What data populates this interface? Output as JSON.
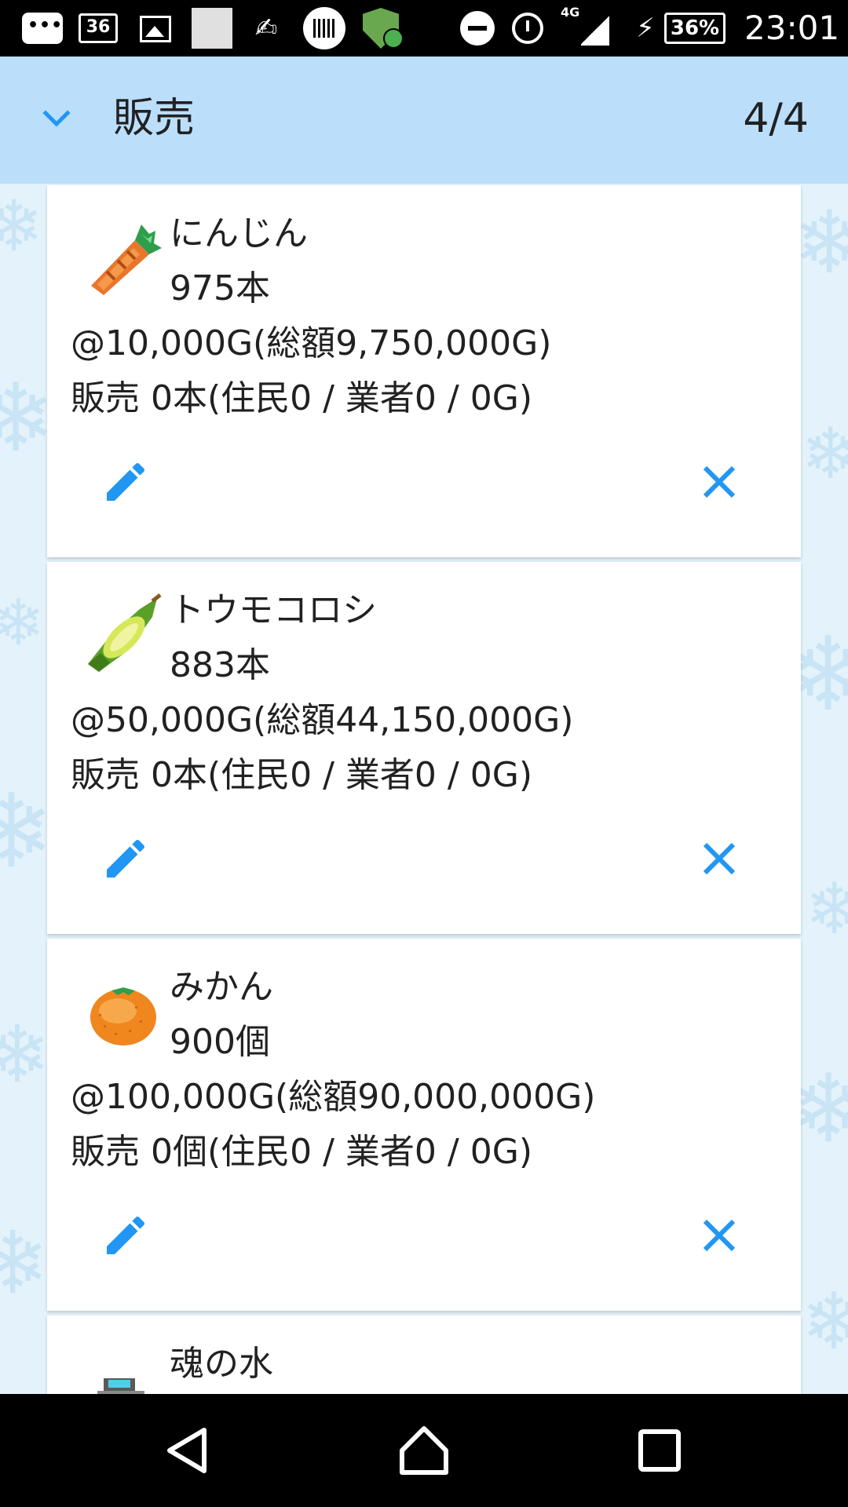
{
  "status_bar": {
    "calendar_day": "36",
    "network": "4G",
    "battery": "36%",
    "time": "23:01"
  },
  "header": {
    "title": "販売",
    "page_counter": "4/4"
  },
  "items": [
    {
      "name": "にんじん",
      "icon": "carrot-icon",
      "quantity": "975本",
      "price": "@10,000G(総額9,750,000G)",
      "sold": "販売 0本(住民0 / 業者0 / 0G)"
    },
    {
      "name": "トウモコロシ",
      "icon": "corn-icon",
      "quantity": "883本",
      "price": "@50,000G(総額44,150,000G)",
      "sold": "販売 0本(住民0 / 業者0 / 0G)"
    },
    {
      "name": "みかん",
      "icon": "mandarin-orange-icon",
      "quantity": "900個",
      "price": "@100,000G(総額90,000,000G)",
      "sold": "販売 0個(住民0 / 業者0 / 0G)"
    },
    {
      "name": "魂の水",
      "icon": "spirit-water-icon"
    }
  ],
  "colors": {
    "header_bg": "#bbdefb",
    "accent": "#2196f3",
    "text": "#212121"
  }
}
